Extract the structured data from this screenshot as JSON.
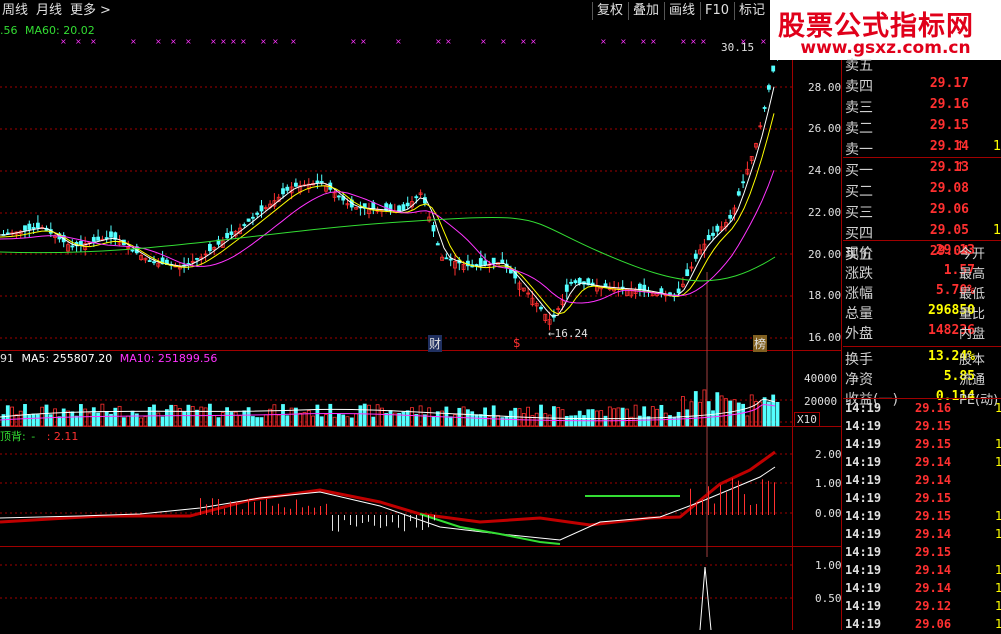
{
  "toolbar": {
    "left": [
      "周线",
      "月线",
      "更多"
    ],
    "more_arrow": ">",
    "right": [
      "复权",
      "叠加",
      "画线",
      "F10",
      "标记"
    ]
  },
  "watermark": {
    "title": "股票公式指标网",
    "url": "www.gsxz.com.cn"
  },
  "price_panel": {
    "header": {
      "ma_prefix": ".56",
      "ma60": "MA60: 20.02"
    },
    "axis_ticks": [
      "28.00",
      "26.00",
      "24.00",
      "22.00",
      "20.00",
      "18.00",
      "16.00"
    ],
    "high_label": "30.15",
    "low_label": "16.24",
    "markers": {
      "cai": "财",
      "s": "$",
      "bang": "榜"
    }
  },
  "volume_panel": {
    "header": {
      "prefix": "91",
      "ma5": "MA5: 255807.20",
      "ma10": "MA10: 251899.56"
    },
    "axis_ticks": [
      "40000",
      "20000"
    ],
    "unit": "X10"
  },
  "indicator_panel": {
    "header": {
      "name": "顶背:",
      "dash": "-",
      "value": ": 2.11"
    },
    "axis_ticks": [
      "2.00",
      "1.00",
      "0.00"
    ]
  },
  "bottom_panel": {
    "axis_ticks": [
      "1.00",
      "0.50"
    ]
  },
  "quote": {
    "order_book": [
      {
        "label": "卖五",
        "price": "",
        "extra": ""
      },
      {
        "label": "卖四",
        "price": "29.17",
        "extra": ""
      },
      {
        "label": "卖三",
        "price": "29.16",
        "extra": ""
      },
      {
        "label": "卖二",
        "price": "29.15",
        "extra": ""
      },
      {
        "label": "卖一",
        "price": "29.14",
        "arrow": "↑",
        "extra": "1"
      },
      {
        "label": "买一",
        "price": "29.13",
        "arrow": "↑",
        "extra": ""
      },
      {
        "label": "买二",
        "price": "29.08",
        "extra": ""
      },
      {
        "label": "买三",
        "price": "29.06",
        "extra": ""
      },
      {
        "label": "买四",
        "price": "29.05",
        "extra": "1"
      },
      {
        "label": "买五",
        "price": "29.04",
        "extra": ""
      }
    ],
    "stats": [
      {
        "label": "现价",
        "value": "29.13",
        "color": "#ff3030",
        "extra": "今开"
      },
      {
        "label": "涨跌",
        "value": "1.57",
        "color": "#ff3030",
        "extra": "最高"
      },
      {
        "label": "涨幅",
        "value": "5.70%",
        "color": "#ff3030",
        "extra": "最低"
      },
      {
        "label": "总量",
        "value": "296850",
        "color": "#ffff00",
        "extra": "量比"
      },
      {
        "label": "外盘",
        "value": "148236",
        "color": "#ff3030",
        "extra": "内盘"
      },
      {
        "label": "换手",
        "value": "13.24%",
        "color": "#ffff00",
        "extra": "股本"
      },
      {
        "label": "净资",
        "value": "5.85",
        "color": "#ffff00",
        "extra": "流通"
      },
      {
        "label": "收益(一)",
        "value": "0.114",
        "color": "#ffff00",
        "extra": "PE(动)"
      }
    ],
    "ticks": [
      {
        "time": "14:19",
        "price": "29.16",
        "vol": "1"
      },
      {
        "time": "14:19",
        "price": "29.15",
        "vol": ""
      },
      {
        "time": "14:19",
        "price": "29.15",
        "vol": "1"
      },
      {
        "time": "14:19",
        "price": "29.14",
        "vol": "1"
      },
      {
        "time": "14:19",
        "price": "29.14",
        "vol": ""
      },
      {
        "time": "14:19",
        "price": "29.15",
        "vol": ""
      },
      {
        "time": "14:19",
        "price": "29.15",
        "vol": "1"
      },
      {
        "time": "14:19",
        "price": "29.14",
        "vol": "1"
      },
      {
        "time": "14:19",
        "price": "29.15",
        "vol": ""
      },
      {
        "time": "14:19",
        "price": "29.14",
        "vol": "1"
      },
      {
        "time": "14:19",
        "price": "29.14",
        "vol": "1"
      },
      {
        "time": "14:19",
        "price": "29.12",
        "vol": "1"
      },
      {
        "time": "14:19",
        "price": "29.06",
        "vol": "1"
      }
    ]
  },
  "colors": {
    "up": "#ff3030",
    "down": "#54ffff",
    "ma5": "#ffffff",
    "ma10": "#ffff00",
    "ma20": "#ff33ff",
    "ma60": "#33dd33",
    "grid": "#a00000",
    "axis_text": "#e0e0e0"
  }
}
